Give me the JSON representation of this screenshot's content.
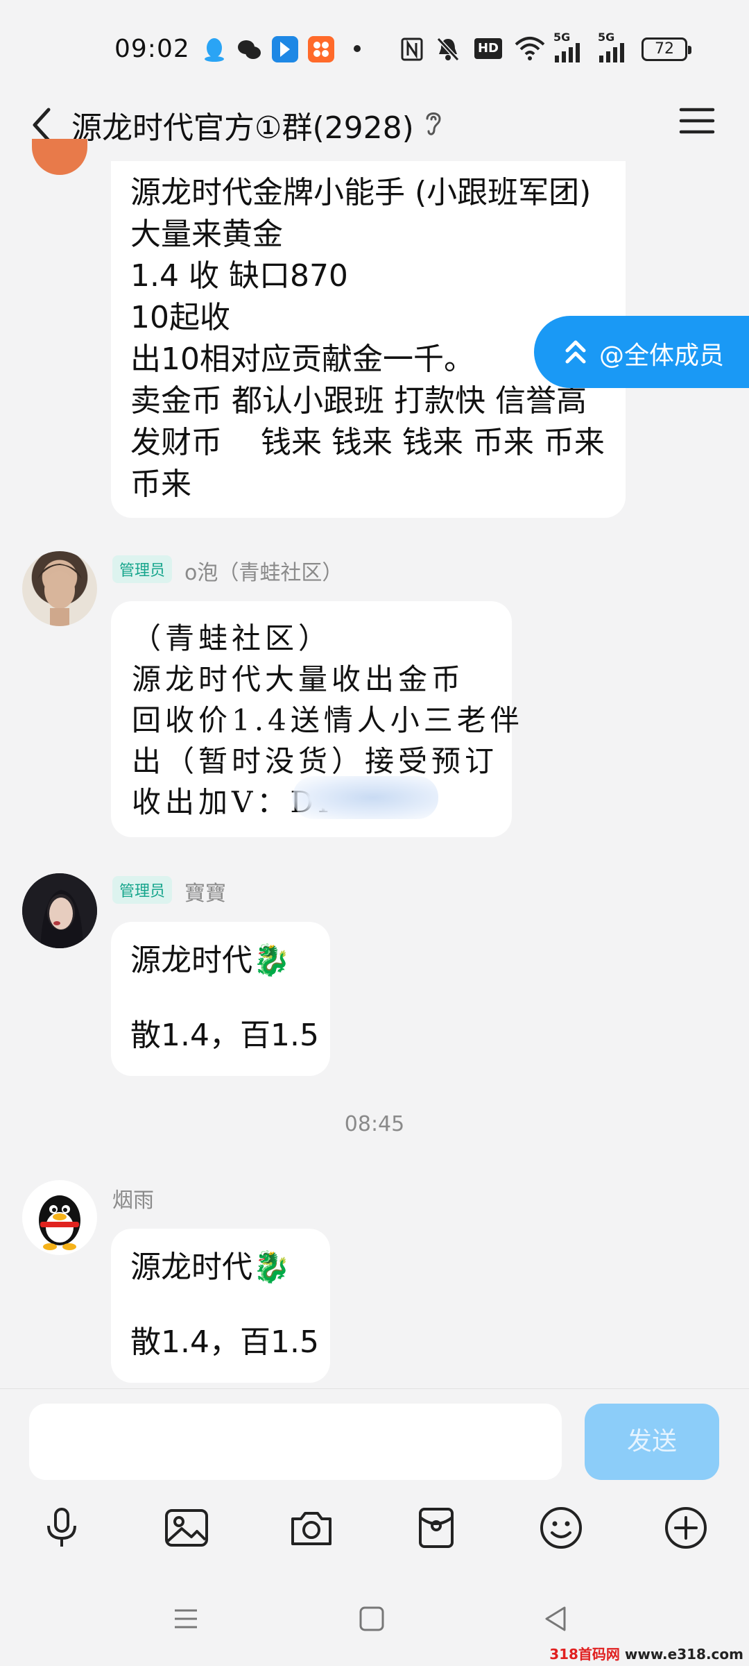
{
  "status_bar": {
    "time": "09:02",
    "network_labels": [
      "5G",
      "5G"
    ],
    "hd_label": "HD",
    "battery": "72"
  },
  "header": {
    "title": "源龙时代官方①群(2928)"
  },
  "at_all": {
    "label": "@全体成员"
  },
  "messages": [
    {
      "lines": "源龙时代金牌小能手 (小跟班军团)\n大量来黄金\n1.4 收 缺口870\n10起收\n出10相对应贡献金一千。\n卖金币 都认小跟班 打款快 信誉高\n发财币    钱来 钱来 钱来 币来 币来\n币来"
    },
    {
      "badge": "管理员",
      "sender": "o泡（青蛙社区）",
      "lines": "（青蛙社区）\n源龙时代大量收出金币\n回收价1.4送情人小三老伴\n出（暂时没货）接受预订\n收出加V：DI"
    },
    {
      "badge": "管理员",
      "sender": "寶寶",
      "line1": "源龙时代🐉",
      "line2": "散1.4，百1.5"
    },
    {
      "sender": "烟雨",
      "line1": "源龙时代🐉",
      "line2": "散1.4，百1.5"
    }
  ],
  "timestamp": "08:45",
  "input": {
    "placeholder": "",
    "send_label": "发送"
  },
  "toolbar": [
    "mic-icon",
    "image-icon",
    "camera-icon",
    "red-packet-icon",
    "emoji-icon",
    "plus-icon"
  ],
  "watermark": {
    "red_part": "318首码网",
    "black_part": " www.e318.com"
  },
  "colors": {
    "accent": "#1a99f5",
    "send_button": "#8ccdf9",
    "admin_badge": "#16a58c",
    "background": "#f3f3f4"
  }
}
